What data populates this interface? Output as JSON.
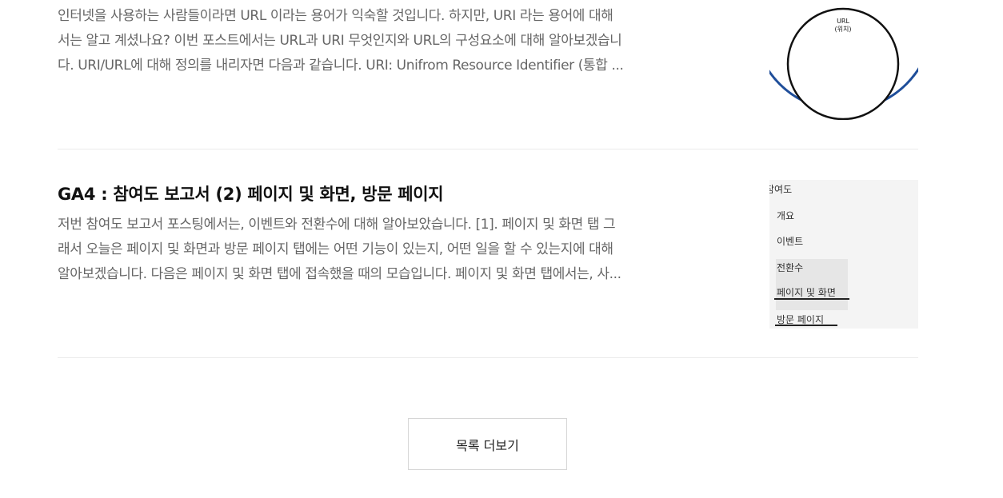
{
  "posts": [
    {
      "excerpt_lines": [
        "인터넷을 사용하는 사람들이라면 URL 이라는 용어가 익숙할 것입니다. 하지만, URI 라는 용어에 대해",
        "서는 알고 계셨나요? 이번 포스트에서는 URL과 URI 무엇인지와 URL의 구성요소에 대해 알아보겠습니",
        "다. URI/URL에 대해 정의를 내리자면 다음과 같습니다. URI: Unifrom Resource Identifier (통합 ..."
      ],
      "thumbnail": {
        "label_line1": "URL",
        "label_line2": "(위치)",
        "outer_ring_color": "#1f4e9a"
      }
    },
    {
      "title": "GA4 : 참여도 보고서 (2) 페이지 및 화면, 방문 페이지",
      "excerpt_lines": [
        "저번 참여도 보고서 포스팅에서는, 이벤트와 전환수에 대해 알아보았습니다. [1]. 페이지 및 화면 탭 그",
        "래서 오늘은 페이지 및 화면과 방문 페이지 탭에는 어떤 기능이 있는지, 어떤 일을 할 수 있는지에 대해",
        "알아보겠습니다. 다음은 페이지 및 화면 탭에 접속했을 때의 모습입니다. 페이지 및 화면 탭에서는, 사..."
      ],
      "thumbnail": {
        "menu_heading": "참여도",
        "menu_items": [
          "개요",
          "이벤트",
          "전환수",
          "페이지 및 화면",
          "방문 페이지"
        ]
      }
    }
  ],
  "more_button_label": "목록 더보기"
}
